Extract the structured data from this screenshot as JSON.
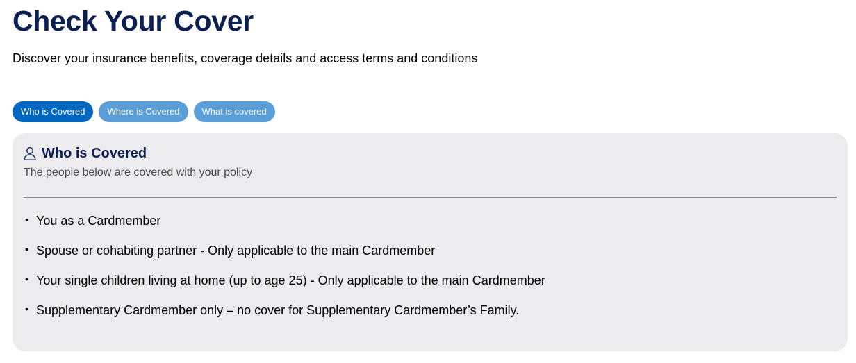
{
  "page": {
    "title": "Check Your Cover",
    "subtitle": "Discover your insurance benefits, coverage details and access terms and conditions"
  },
  "tabs": [
    {
      "label": "Who is Covered",
      "active": true
    },
    {
      "label": "Where is Covered",
      "active": false
    },
    {
      "label": "What is covered",
      "active": false
    }
  ],
  "card": {
    "icon": "person-icon",
    "title": "Who is Covered",
    "description": "The people below are covered with your policy",
    "bullet_symbol": "•",
    "items": [
      "You as a Cardmember",
      "Spouse or cohabiting partner - Only applicable to the main Cardmember",
      "Your single children living at home (up to age 25) - Only applicable to the main Cardmember",
      "Supplementary Cardmember only – no cover for Supplementary Cardmember’s Family."
    ]
  },
  "colors": {
    "heading": "#0c1f52",
    "tab_active": "#0067c0",
    "tab_inactive": "#5a9fd8",
    "card_background": "#ececee"
  }
}
